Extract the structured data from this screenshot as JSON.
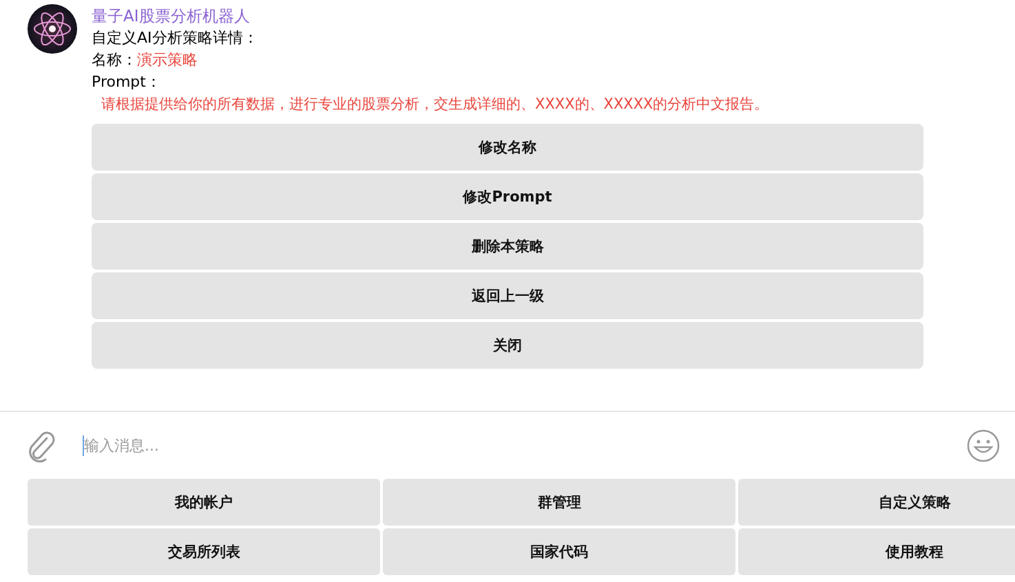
{
  "message": {
    "sender": "量子AI股票分析机器人",
    "heading": "自定义AI分析策略详情：",
    "name_label": "名称：",
    "name_value": "演示策略",
    "prompt_label": "Prompt：",
    "prompt_value": "请根据提供给你的所有数据，进行专业的股票分析，交生成详细的、XXXX的、XXXXX的分析中文报告。"
  },
  "inline_buttons": [
    "修改名称",
    "修改Prompt",
    "删除本策略",
    "返回上一级",
    "关闭"
  ],
  "composer": {
    "placeholder": "输入消息..."
  },
  "keyboard": [
    [
      "我的帐户",
      "群管理",
      "自定义策略"
    ],
    [
      "交易所列表",
      "国家代码",
      "使用教程"
    ]
  ]
}
